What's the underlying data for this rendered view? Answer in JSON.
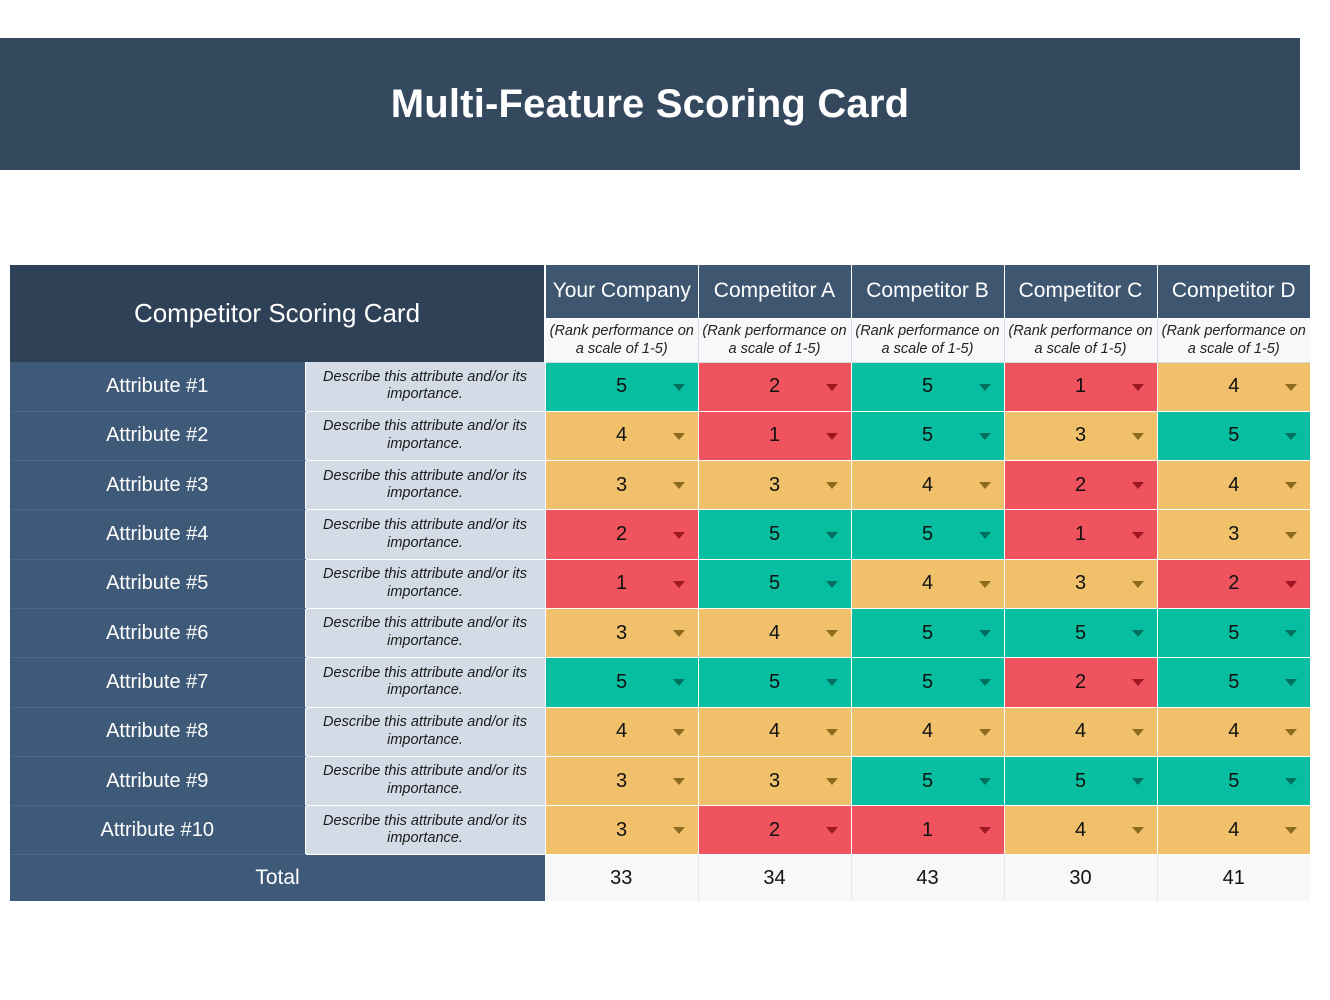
{
  "banner": {
    "title": "Multi-Feature Scoring Card"
  },
  "table": {
    "card_title": "Competitor Scoring Card",
    "rank_note": "(Rank performance on a scale of 1-5)",
    "description_placeholder": "Describe this attribute and/or its importance.",
    "total_label": "Total",
    "columns": [
      "Your Company",
      "Competitor A",
      "Competitor B",
      "Competitor C",
      "Competitor D"
    ],
    "rows": [
      {
        "attribute": "Attribute #1",
        "scores": [
          5,
          2,
          5,
          1,
          4
        ]
      },
      {
        "attribute": "Attribute #2",
        "scores": [
          4,
          1,
          5,
          3,
          5
        ]
      },
      {
        "attribute": "Attribute #3",
        "scores": [
          3,
          3,
          4,
          2,
          4
        ]
      },
      {
        "attribute": "Attribute #4",
        "scores": [
          2,
          5,
          5,
          1,
          3
        ]
      },
      {
        "attribute": "Attribute #5",
        "scores": [
          1,
          5,
          4,
          3,
          2
        ]
      },
      {
        "attribute": "Attribute #6",
        "scores": [
          3,
          4,
          5,
          5,
          5
        ]
      },
      {
        "attribute": "Attribute #7",
        "scores": [
          5,
          5,
          5,
          2,
          5
        ]
      },
      {
        "attribute": "Attribute #8",
        "scores": [
          4,
          4,
          4,
          4,
          4
        ]
      },
      {
        "attribute": "Attribute #9",
        "scores": [
          3,
          3,
          5,
          5,
          5
        ]
      },
      {
        "attribute": "Attribute #10",
        "scores": [
          3,
          2,
          1,
          4,
          4
        ]
      }
    ],
    "totals": [
      33,
      34,
      43,
      30,
      41
    ]
  },
  "colors": {
    "banner_navy": "#34485E",
    "header_navy": "#2F4156",
    "attribute_slate": "#3F5A78",
    "description_grey": "#D3DCE6",
    "score_high_green": "#07BFA0",
    "score_mid_amber": "#F0C06B",
    "score_low_red": "#EF535E",
    "total_background": "#F7F8FA"
  },
  "chart_data": {
    "type": "heatmap",
    "title": "Competitor Scoring Card",
    "xlabel": "",
    "ylabel": "",
    "categories": [
      "Attribute #1",
      "Attribute #2",
      "Attribute #3",
      "Attribute #4",
      "Attribute #5",
      "Attribute #6",
      "Attribute #7",
      "Attribute #8",
      "Attribute #9",
      "Attribute #10"
    ],
    "series": [
      {
        "name": "Your Company",
        "values": [
          5,
          4,
          3,
          2,
          1,
          3,
          5,
          4,
          3,
          3
        ],
        "total": 33
      },
      {
        "name": "Competitor A",
        "values": [
          2,
          1,
          3,
          5,
          5,
          4,
          5,
          4,
          3,
          2
        ],
        "total": 34
      },
      {
        "name": "Competitor B",
        "values": [
          5,
          5,
          4,
          5,
          4,
          5,
          5,
          4,
          5,
          1
        ],
        "total": 43
      },
      {
        "name": "Competitor C",
        "values": [
          1,
          3,
          2,
          1,
          3,
          5,
          2,
          4,
          5,
          4
        ],
        "total": 30
      },
      {
        "name": "Competitor D",
        "values": [
          4,
          5,
          4,
          3,
          2,
          5,
          5,
          4,
          5,
          4
        ],
        "total": 41
      }
    ],
    "value_range": [
      1,
      5
    ],
    "color_scale": {
      "1": "#EF535E",
      "2": "#EF535E",
      "3": "#F0C06B",
      "4": "#F0C06B",
      "5": "#07BFA0"
    },
    "legend": "(Rank performance on a scale of 1-5)",
    "grid": true
  }
}
